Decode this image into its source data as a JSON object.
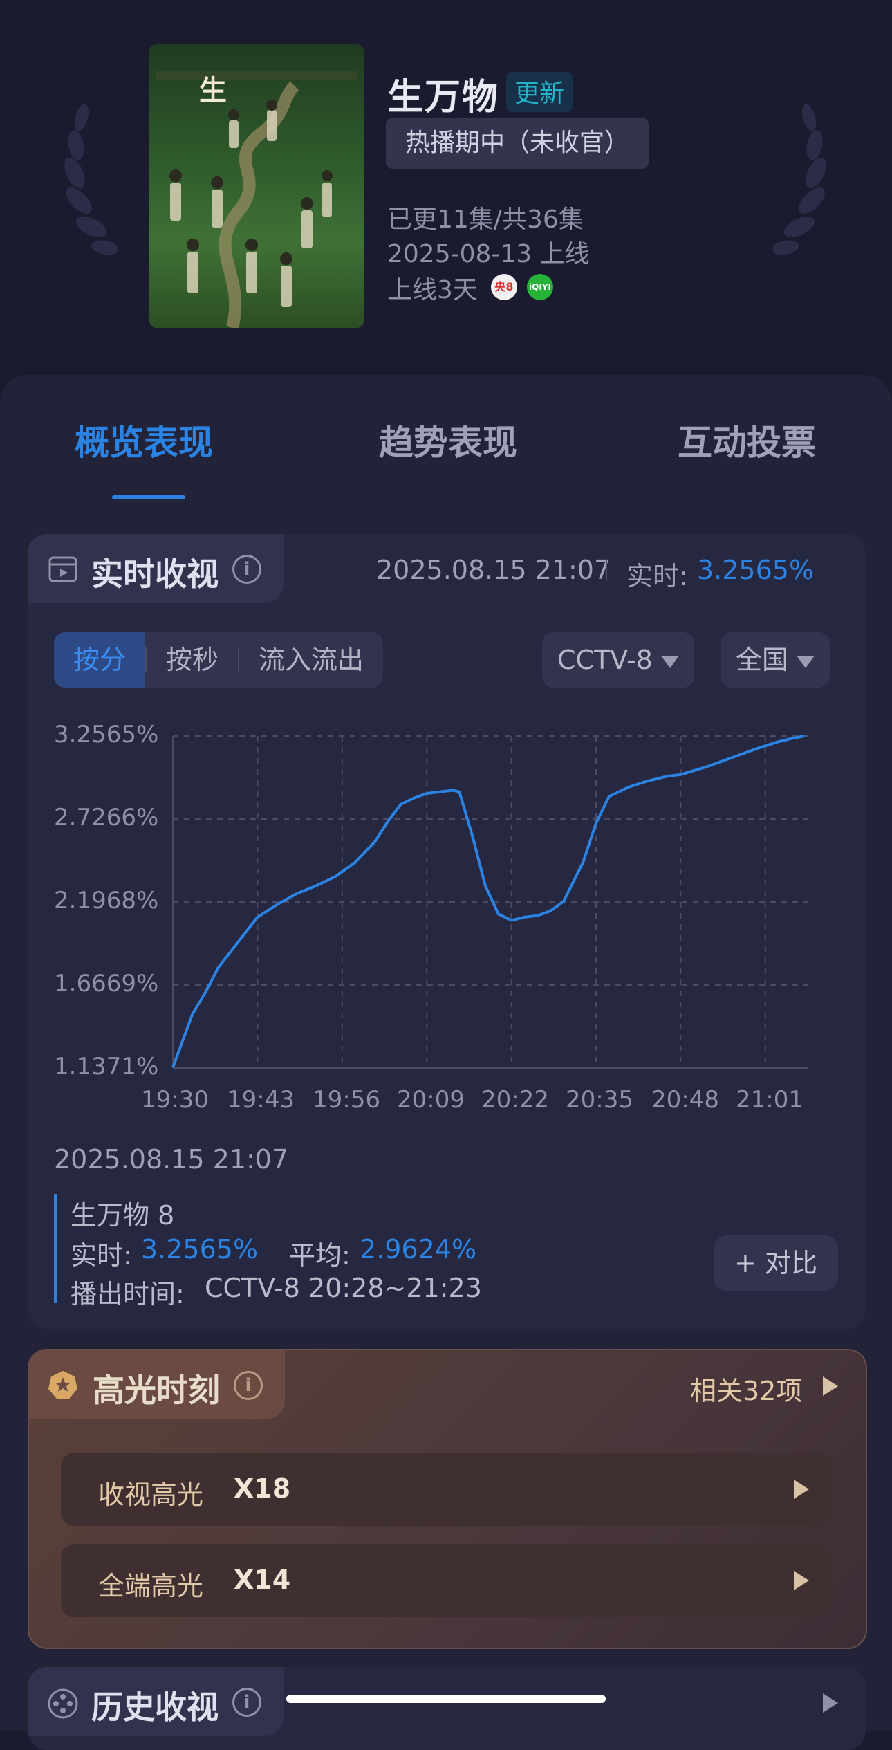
{
  "show": {
    "title": "生万物",
    "update_badge": "更新",
    "status": "热播期中（未收官）",
    "episodes": "已更11集/共36集",
    "premiere": "2025-08-13 上线",
    "days_online": "上线3天",
    "platform_icons": [
      "cctv8-logo",
      "iqiyi-logo"
    ],
    "cctv8_logo_text": "央8",
    "iqiyi_logo_text": "iQIYI"
  },
  "tabs": [
    {
      "label": "概览表现",
      "active": true
    },
    {
      "label": "趋势表现",
      "active": false
    },
    {
      "label": "互动投票",
      "active": false
    }
  ],
  "realtime": {
    "section_title": "实时收视",
    "timestamp": "2025.08.15 21:07",
    "realtime_label": "实时:",
    "realtime_value": "3.2565%",
    "segments": [
      {
        "label": "按分",
        "active": true
      },
      {
        "label": "按秒",
        "active": false
      },
      {
        "label": "流入流出",
        "active": false
      }
    ],
    "channel": "CCTV-8",
    "region": "全国"
  },
  "chart_data": {
    "type": "line",
    "x_ticks": [
      "19:30",
      "19:43",
      "19:56",
      "20:09",
      "20:22",
      "20:35",
      "20:48",
      "21:01"
    ],
    "y_ticks": [
      "3.2565%",
      "2.7266%",
      "2.1968%",
      "1.6669%",
      "1.1371%"
    ],
    "ylim": [
      1.1371,
      3.2565
    ],
    "x_start": "19:30",
    "x_end": "21:07",
    "grid": true,
    "series": [
      {
        "values": [
          [
            "19:30",
            1.14
          ],
          [
            "19:33",
            1.48
          ],
          [
            "19:35",
            1.62
          ],
          [
            "19:37",
            1.78
          ],
          [
            "19:40",
            1.94
          ],
          [
            "19:43",
            2.1
          ],
          [
            "19:46",
            2.18
          ],
          [
            "19:49",
            2.25
          ],
          [
            "19:52",
            2.3
          ],
          [
            "19:55",
            2.36
          ],
          [
            "19:58",
            2.45
          ],
          [
            "20:01",
            2.58
          ],
          [
            "20:03",
            2.71
          ],
          [
            "20:05",
            2.82
          ],
          [
            "20:07",
            2.86
          ],
          [
            "20:09",
            2.89
          ],
          [
            "20:11",
            2.9
          ],
          [
            "20:13",
            2.91
          ],
          [
            "20:14",
            2.9
          ],
          [
            "20:16",
            2.62
          ],
          [
            "20:18",
            2.3
          ],
          [
            "20:20",
            2.12
          ],
          [
            "20:22",
            2.08
          ],
          [
            "20:24",
            2.1
          ],
          [
            "20:26",
            2.11
          ],
          [
            "20:28",
            2.14
          ],
          [
            "20:30",
            2.2
          ],
          [
            "20:33",
            2.45
          ],
          [
            "20:35",
            2.7
          ],
          [
            "20:37",
            2.87
          ],
          [
            "20:40",
            2.93
          ],
          [
            "20:43",
            2.97
          ],
          [
            "20:46",
            3.0
          ],
          [
            "20:48",
            3.01
          ],
          [
            "20:52",
            3.06
          ],
          [
            "20:56",
            3.12
          ],
          [
            "21:00",
            3.18
          ],
          [
            "21:03",
            3.22
          ],
          [
            "21:05",
            3.24
          ],
          [
            "21:07",
            3.2565
          ]
        ]
      }
    ]
  },
  "legend": {
    "timestamp": "2025.08.15 21:07",
    "show_episode": "生万物 8",
    "realtime_label": "实时:",
    "realtime_value": "3.2565%",
    "average_label": "平均:",
    "average_value": "2.9624%",
    "airtime_label": "播出时间:",
    "airtime_value": "CCTV-8 20:28~21:23"
  },
  "compare_button": "+ 对比",
  "highlights": {
    "section_title": "高光时刻",
    "related": "相关32项",
    "rows": [
      {
        "label": "收视高光",
        "value": "X18"
      },
      {
        "label": "全端高光",
        "value": "X14"
      }
    ]
  },
  "history": {
    "section_title": "历史收视"
  },
  "colors": {
    "accent": "#2b83e4",
    "background": "#1b1b30",
    "panel": "#222338",
    "highlight_gold": "#e2c9a8"
  }
}
